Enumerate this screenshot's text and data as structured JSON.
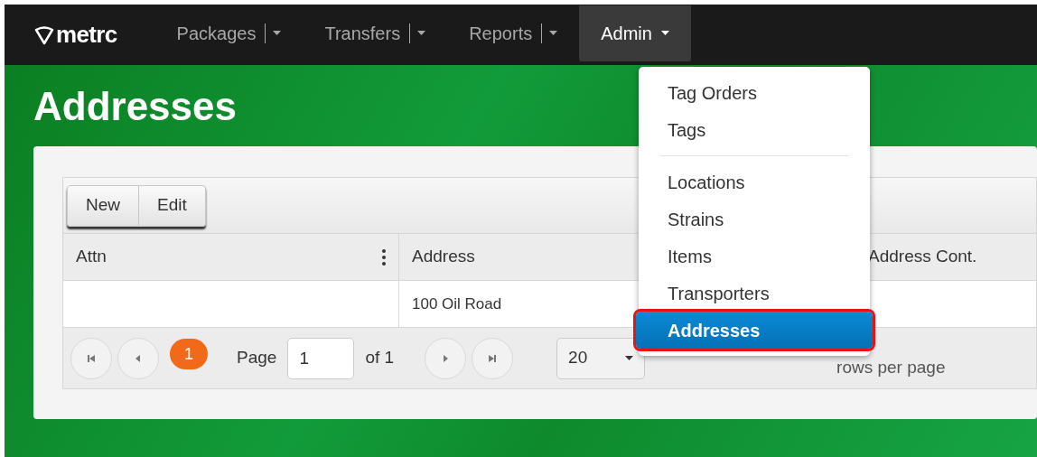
{
  "navbar": {
    "logo": "metrc",
    "items": [
      {
        "label": "Packages",
        "split": true,
        "selected": false
      },
      {
        "label": "Transfers",
        "split": true,
        "selected": false
      },
      {
        "label": "Reports",
        "split": true,
        "selected": false
      },
      {
        "label": "Admin",
        "split": false,
        "selected": true
      }
    ]
  },
  "page_title": "Addresses",
  "toolbar": {
    "buttons": [
      "New",
      "Edit"
    ]
  },
  "table": {
    "columns": [
      {
        "label": "Attn",
        "menu": true
      },
      {
        "label": "Address",
        "menu": false
      },
      {
        "label": "Address Cont.",
        "menu": false
      }
    ],
    "rows": [
      {
        "address": "100 Oil Road"
      }
    ]
  },
  "pager": {
    "current_page": "1",
    "page_label": "Page",
    "page_input": "1",
    "page_count": "of 1",
    "page_size": "20",
    "rows_per_page": "rows per page"
  },
  "admin_menu": {
    "items": [
      {
        "kind": "item",
        "label": "Tag Orders",
        "selected": false
      },
      {
        "kind": "item",
        "label": "Tags",
        "selected": false
      },
      {
        "kind": "divider"
      },
      {
        "kind": "item",
        "label": "Locations",
        "selected": false
      },
      {
        "kind": "item",
        "label": "Strains",
        "selected": false
      },
      {
        "kind": "item",
        "label": "Items",
        "selected": false
      },
      {
        "kind": "item",
        "label": "Transporters",
        "selected": false
      },
      {
        "kind": "item",
        "label": "Addresses",
        "selected": true
      }
    ]
  }
}
